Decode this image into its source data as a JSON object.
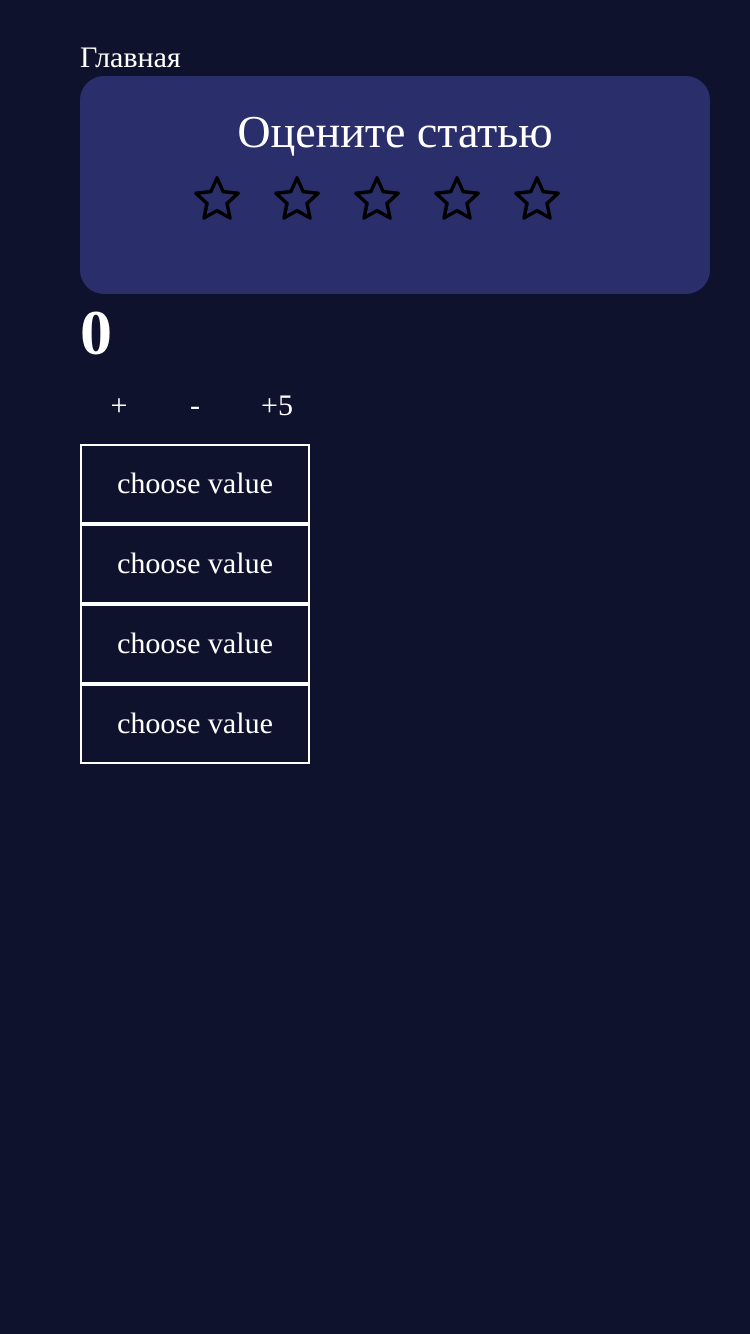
{
  "nav": {
    "home_label": "Главная"
  },
  "rating": {
    "title": "Оцените статью",
    "stars_total": 5,
    "stars_selected": 0,
    "star_icon": "star-outline-icon"
  },
  "counter": {
    "value": "0",
    "buttons": {
      "plus_label": "+",
      "minus_label": "-",
      "plus_five_label": "+5"
    }
  },
  "selects": [
    {
      "label": "choose value"
    },
    {
      "label": "choose value"
    },
    {
      "label": "choose value"
    },
    {
      "label": "choose value"
    }
  ],
  "colors": {
    "background": "#0e122d",
    "card": "#2a2e6a",
    "text": "#ffffff",
    "star_stroke": "#000000"
  }
}
